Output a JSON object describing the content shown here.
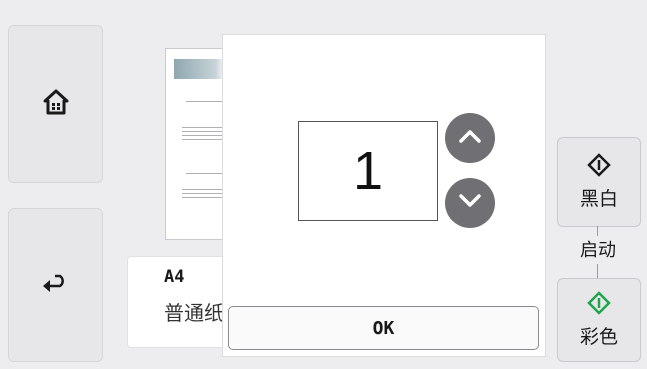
{
  "nav": {
    "home_icon": "home-icon",
    "back_icon": "back-arrow-icon"
  },
  "media": {
    "size": "A4",
    "type": "普通纸"
  },
  "copies_dialog": {
    "value": "1",
    "up_icon": "chevron-up-icon",
    "down_icon": "chevron-down-icon",
    "ok_label": "OK"
  },
  "start": {
    "label": "启动",
    "bw_label": "黑白",
    "color_label": "彩色",
    "bw_icon_color": "#1a1a1a",
    "color_icon_color": "#1fa44a"
  }
}
